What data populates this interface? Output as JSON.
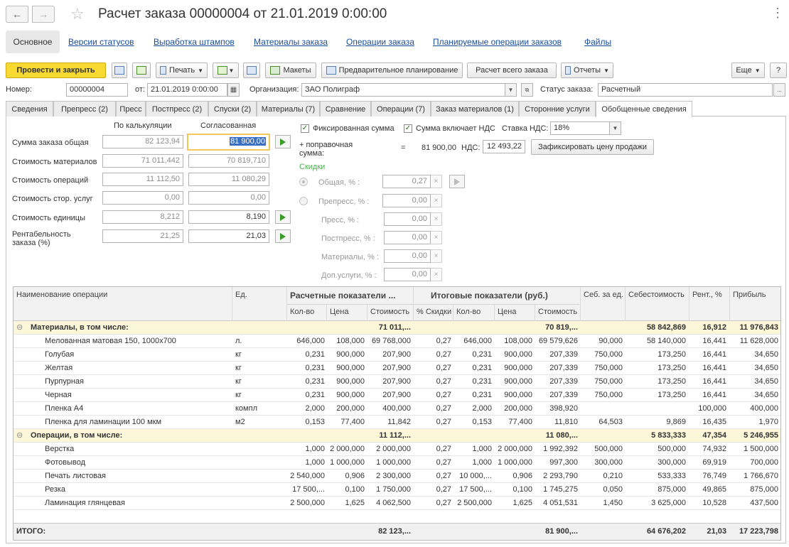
{
  "window": {
    "title": "Расчет заказа 00000004 от 21.01.2019 0:00:00"
  },
  "sections": {
    "active": "Основное",
    "links": [
      "Версии статусов",
      "Выработка штампов",
      "Материалы заказа",
      "Операции заказа",
      "Планируемые операции заказов",
      "Файлы"
    ]
  },
  "toolbar": {
    "post_close": "Провести и закрыть",
    "print": "Печать",
    "layouts": "Макеты",
    "pre_planning": "Предварительное планирование",
    "calc_all": "Расчет всего заказа",
    "reports": "Отчеты",
    "more": "Еще",
    "help": "?"
  },
  "header": {
    "number_label": "Номер:",
    "number_value": "00000004",
    "date_label": "от:",
    "date_value": "21.01.2019  0:00:00",
    "org_label": "Организация:",
    "org_value": "ЗАО Полиграф",
    "status_label": "Статус заказа:",
    "status_value": "Расчетный"
  },
  "tabs": [
    "Сведения",
    "Препресс (2)",
    "Пресс",
    "Постпресс (2)",
    "Спуски (2)",
    "Материалы (7)",
    "Сравнение",
    "Операции (7)",
    "Заказ материалов (1)",
    "Сторонние услуги",
    "Обобщенные сведения"
  ],
  "tabs_active": "Обобщенные сведения",
  "summary": {
    "col_calc": "По калькуляции",
    "col_agreed": "Согласованная",
    "rows": [
      {
        "label": "Сумма заказа общая",
        "calc": "82 123,94",
        "agreed": "81 900,00"
      },
      {
        "label": "Стоимость материалов",
        "calc": "71 011,442",
        "agreed": "70 819,710"
      },
      {
        "label": "Стоимость операций",
        "calc": "11 112,50",
        "agreed": "11 080,29"
      },
      {
        "label": "Стоимость стор. услуг",
        "calc": "0,00",
        "agreed": "0,00"
      },
      {
        "label": "Стоимость единицы",
        "calc": "8,212",
        "agreed": "8,190"
      },
      {
        "label": "Рентабельность заказа (%)",
        "calc": "21,25",
        "agreed": "21,03"
      }
    ]
  },
  "pricing": {
    "fixed_sum_label": "Фиксированная сумма",
    "vat_included_label": "Сумма включает НДС",
    "vat_rate_label": "Ставка НДС:",
    "vat_rate_value": "18%",
    "correction_label": "+ поправочная сумма:",
    "eq": "=",
    "correction_value": "81 900,00",
    "vat_label": "НДС:",
    "vat_value": "12 493,22",
    "fix_price_button": "Зафиксировать цену продажи",
    "discounts_title": "Скидки",
    "discounts": [
      {
        "label": "Общая, % :",
        "value": "0,27"
      },
      {
        "label": "Препресс, % :",
        "value": "0,00"
      },
      {
        "label": "Пресс, % :",
        "value": "0,00"
      },
      {
        "label": "Постпресс, % :",
        "value": "0,00"
      },
      {
        "label": "Материалы, % :",
        "value": "0,00"
      },
      {
        "label": "Доп.услуги, % :",
        "value": "0,00"
      }
    ]
  },
  "table": {
    "headers": {
      "name": "Наименование операции",
      "unit": "Ед.",
      "calc_group": "Расчетные показатели ...",
      "final_group": "Итоговые показатели (руб.)",
      "unit_cost": "Себ. за ед.",
      "cost": "Себестоимость",
      "profitability": "Рент., %",
      "profit": "Прибыль",
      "qty": "Кол-во",
      "price": "Цена",
      "amount": "Стоимость",
      "discount": "% Скидки",
      "qty2": "Кол-во",
      "price2": "Цена",
      "amount2": "Стоимость"
    },
    "rows": [
      {
        "group": true,
        "name": "Материалы, в том числе:",
        "unit": "",
        "qty": "",
        "price": "",
        "amount": "71 011,...",
        "disc": "",
        "qty2": "",
        "price2": "",
        "amount2": "70 819,...",
        "ucost": "",
        "cost": "58 842,869",
        "rent": "16,912",
        "profit": "11 976,843"
      },
      {
        "group": false,
        "name": "Мелованная матовая 150, 1000x700",
        "unit": "л.",
        "qty": "646,000",
        "price": "108,000",
        "amount": "69 768,000",
        "disc": "0,27",
        "qty2": "646,000",
        "price2": "108,000",
        "amount2": "69 579,626",
        "ucost": "90,000",
        "cost": "58 140,000",
        "rent": "16,441",
        "profit": "11 628,000"
      },
      {
        "group": false,
        "name": "Голубая",
        "unit": "кг",
        "qty": "0,231",
        "price": "900,000",
        "amount": "207,900",
        "disc": "0,27",
        "qty2": "0,231",
        "price2": "900,000",
        "amount2": "207,339",
        "ucost": "750,000",
        "cost": "173,250",
        "rent": "16,441",
        "profit": "34,650"
      },
      {
        "group": false,
        "name": "Желтая",
        "unit": "кг",
        "qty": "0,231",
        "price": "900,000",
        "amount": "207,900",
        "disc": "0,27",
        "qty2": "0,231",
        "price2": "900,000",
        "amount2": "207,339",
        "ucost": "750,000",
        "cost": "173,250",
        "rent": "16,441",
        "profit": "34,650"
      },
      {
        "group": false,
        "name": "Пурпурная",
        "unit": "кг",
        "qty": "0,231",
        "price": "900,000",
        "amount": "207,900",
        "disc": "0,27",
        "qty2": "0,231",
        "price2": "900,000",
        "amount2": "207,339",
        "ucost": "750,000",
        "cost": "173,250",
        "rent": "16,441",
        "profit": "34,650"
      },
      {
        "group": false,
        "name": "Черная",
        "unit": "кг",
        "qty": "0,231",
        "price": "900,000",
        "amount": "207,900",
        "disc": "0,27",
        "qty2": "0,231",
        "price2": "900,000",
        "amount2": "207,339",
        "ucost": "750,000",
        "cost": "173,250",
        "rent": "16,441",
        "profit": "34,650"
      },
      {
        "group": false,
        "name": "Пленка А4",
        "unit": "компл",
        "qty": "2,000",
        "price": "200,000",
        "amount": "400,000",
        "disc": "0,27",
        "qty2": "2,000",
        "price2": "200,000",
        "amount2": "398,920",
        "ucost": "",
        "cost": "",
        "rent": "100,000",
        "profit": "400,000"
      },
      {
        "group": false,
        "name": "Пленка для ламинации 100 мкм",
        "unit": "м2",
        "qty": "0,153",
        "price": "77,400",
        "amount": "11,842",
        "disc": "0,27",
        "qty2": "0,153",
        "price2": "77,400",
        "amount2": "11,810",
        "ucost": "64,503",
        "cost": "9,869",
        "rent": "16,435",
        "profit": "1,970"
      },
      {
        "group": true,
        "name": "Операции, в том числе:",
        "unit": "",
        "qty": "",
        "price": "",
        "amount": "11 112,...",
        "disc": "",
        "qty2": "",
        "price2": "",
        "amount2": "11 080,...",
        "ucost": "",
        "cost": "5 833,333",
        "rent": "47,354",
        "profit": "5 246,955"
      },
      {
        "group": false,
        "name": "Верстка",
        "unit": "",
        "qty": "1,000",
        "price": "2 000,000",
        "amount": "2 000,000",
        "disc": "0,27",
        "qty2": "1,000",
        "price2": "2 000,000",
        "amount2": "1 992,392",
        "ucost": "500,000",
        "cost": "500,000",
        "rent": "74,932",
        "profit": "1 500,000"
      },
      {
        "group": false,
        "name": "Фотовывод",
        "unit": "",
        "qty": "1,000",
        "price": "1 000,000",
        "amount": "1 000,000",
        "disc": "0,27",
        "qty2": "1,000",
        "price2": "1 000,000",
        "amount2": "997,300",
        "ucost": "300,000",
        "cost": "300,000",
        "rent": "69,919",
        "profit": "700,000"
      },
      {
        "group": false,
        "name": "Печать листовая",
        "unit": "",
        "qty": "2 540,000",
        "price": "0,906",
        "amount": "2 300,000",
        "disc": "0,27",
        "qty2": "10 000,...",
        "price2": "0,906",
        "amount2": "2 293,790",
        "ucost": "0,210",
        "cost": "533,333",
        "rent": "76,749",
        "profit": "1 766,670"
      },
      {
        "group": false,
        "name": "Резка",
        "unit": "",
        "qty": "17 500,...",
        "price": "0,100",
        "amount": "1 750,000",
        "disc": "0,27",
        "qty2": "17 500,...",
        "price2": "0,100",
        "amount2": "1 745,275",
        "ucost": "0,050",
        "cost": "875,000",
        "rent": "49,865",
        "profit": "875,000"
      },
      {
        "group": false,
        "name": "Ламинация глянцевая",
        "unit": "",
        "qty": "2 500,000",
        "price": "1,625",
        "amount": "4 062,500",
        "disc": "0,27",
        "qty2": "2 500,000",
        "price2": "1,625",
        "amount2": "4 051,531",
        "ucost": "1,450",
        "cost": "3 625,000",
        "rent": "10,528",
        "profit": "437,500"
      }
    ],
    "total": {
      "label": "ИТОГО:",
      "amount": "82 123,...",
      "amount2": "81 900,...",
      "cost": "64 676,202",
      "rent": "21,03",
      "profit": "17 223,798"
    }
  }
}
